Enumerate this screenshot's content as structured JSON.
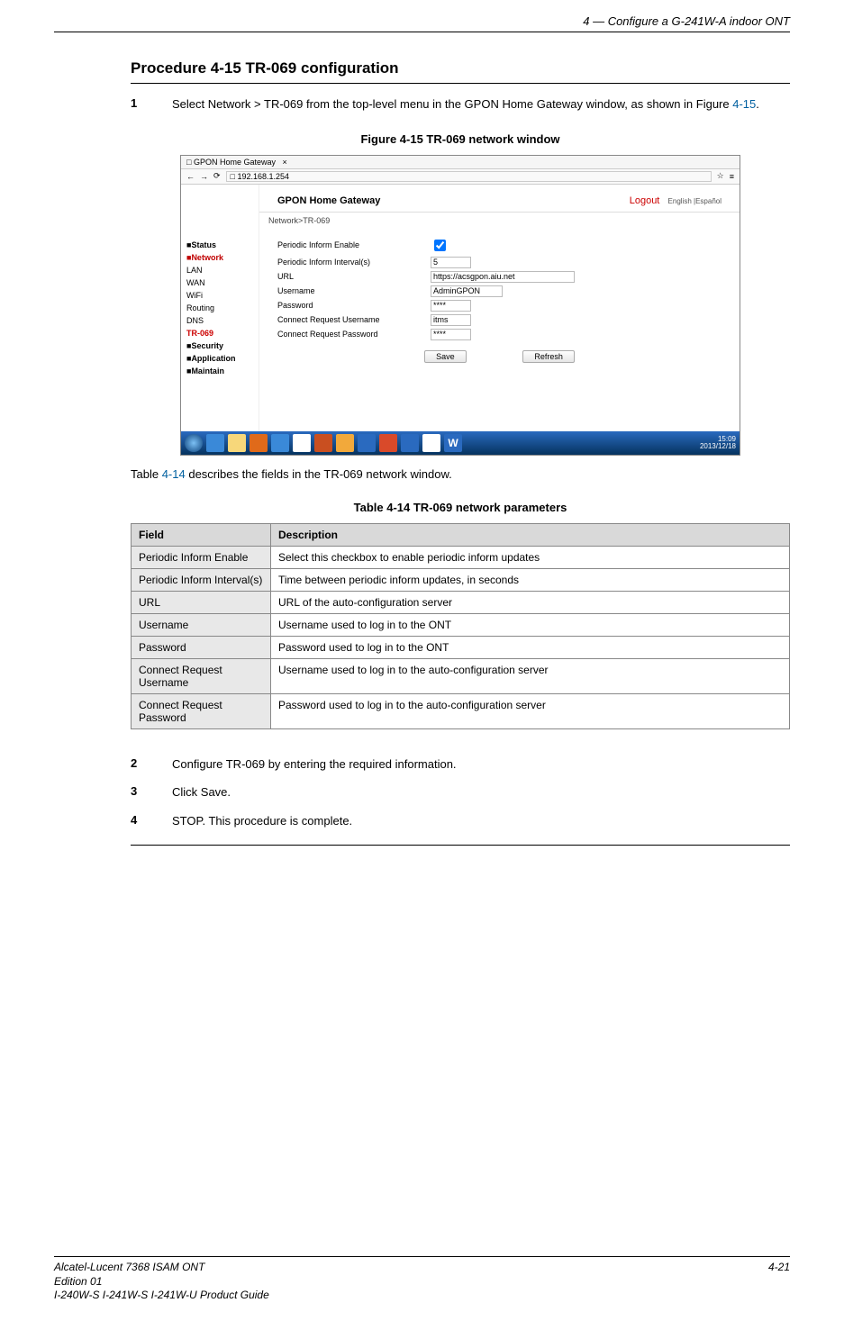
{
  "header": {
    "chapter": "4 —  Configure a G-241W-A indoor ONT"
  },
  "procedure": {
    "title": "Procedure 4-15  TR-069 configuration",
    "step1_num": "1",
    "step1_text_a": "Select Network > TR-069 from the top-level menu in the GPON Home Gateway window, as shown in Figure ",
    "step1_link": "4-15",
    "step1_text_b": ".",
    "step2_num": "2",
    "step2_text": "Configure TR-069 by entering the required information.",
    "step3_num": "3",
    "step3_text": "Click Save.",
    "step4_num": "4",
    "step4_text": "STOP. This procedure is complete."
  },
  "figure": {
    "caption": "Figure 4-15  TR-069 network window",
    "tab_title": "GPON Home Gateway",
    "url": "192.168.1.254",
    "page_title": "GPON Home Gateway",
    "logout": "Logout",
    "langs": "English |Español",
    "breadcrumb": "Network>TR-069",
    "side": {
      "status": "Status",
      "network": "Network",
      "lan": "LAN",
      "wan": "WAN",
      "wifi": "WiFi",
      "routing": "Routing",
      "dns": "DNS",
      "tr069": "TR-069",
      "security": "Security",
      "application": "Application",
      "maintain": "Maintain"
    },
    "form": {
      "periodic_enable_lbl": "Periodic Inform Enable",
      "periodic_interval_lbl": "Periodic Inform Interval(s)",
      "periodic_interval_val": "5",
      "url_lbl": "URL",
      "url_val": "https://acsgpon.aiu.net",
      "username_lbl": "Username",
      "username_val": "AdminGPON",
      "password_lbl": "Password",
      "password_val": "****",
      "creq_user_lbl": "Connect Request Username",
      "creq_user_val": "itms",
      "creq_pass_lbl": "Connect Request Password",
      "creq_pass_val": "****",
      "save_btn": "Save",
      "refresh_btn": "Refresh"
    },
    "taskbar_time": "15:09",
    "taskbar_date": "2013/12/18"
  },
  "intertext": {
    "prefix": "Table ",
    "link": "4-14",
    "suffix": " describes the fields in the TR-069 network window."
  },
  "table": {
    "caption": "Table 4-14 TR-069 network parameters",
    "head_field": "Field",
    "head_desc": "Description",
    "rows": [
      {
        "f": "Periodic Inform Enable",
        "d": "Select this checkbox to enable periodic inform updates"
      },
      {
        "f": "Periodic Inform Interval(s)",
        "d": "Time between periodic inform updates, in seconds"
      },
      {
        "f": "URL",
        "d": "URL of the auto-configuration server"
      },
      {
        "f": "Username",
        "d": "Username used to log in to the ONT"
      },
      {
        "f": "Password",
        "d": "Password used to log in to the ONT"
      },
      {
        "f": "Connect Request Username",
        "d": "Username used to log in to the auto-configuration server"
      },
      {
        "f": "Connect Request Password",
        "d": "Password used to log in to the auto-configuration server"
      }
    ]
  },
  "footer": {
    "line1": "Alcatel-Lucent 7368 ISAM ONT",
    "line2": "Edition 01",
    "line3": "I-240W-S I-241W-S I-241W-U Product Guide",
    "page": "4-21"
  }
}
